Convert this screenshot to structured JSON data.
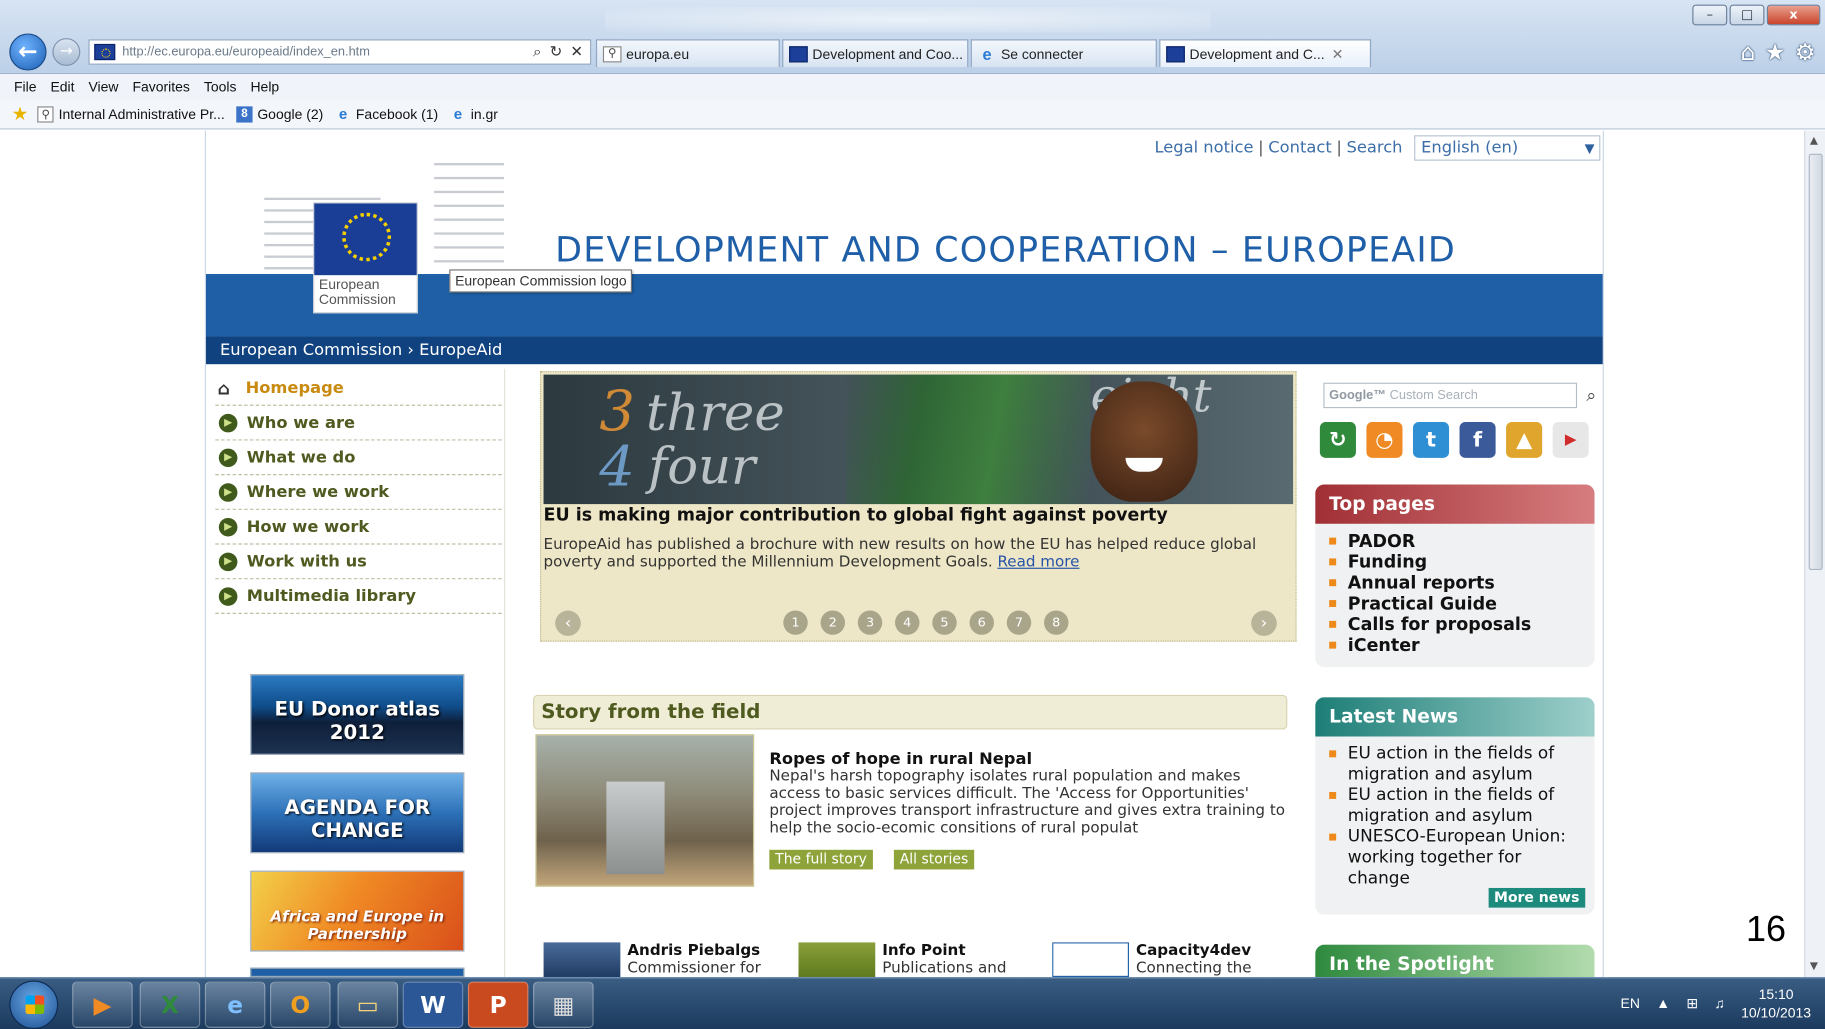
{
  "browser": {
    "address_url": "http://ec.europa.eu/europeaid/index_en.htm",
    "tabs": [
      {
        "label": "europa.eu",
        "icon": "person-page-icon"
      },
      {
        "label": "Development and Coo...",
        "icon": "eu-flag-icon"
      },
      {
        "label": "Se connecter",
        "icon": "ie-icon"
      },
      {
        "label": "Development and C...",
        "icon": "eu-flag-icon",
        "active": true
      }
    ],
    "menu": [
      "File",
      "Edit",
      "View",
      "Favorites",
      "Tools",
      "Help"
    ],
    "favorites": [
      {
        "label": "Internal Administrative Pr...",
        "icon": "person-page-icon"
      },
      {
        "label": "Google (2)",
        "icon": "google-icon"
      },
      {
        "label": "Facebook (1)",
        "icon": "ie-icon"
      },
      {
        "label": "in.gr",
        "icon": "ie-icon"
      }
    ]
  },
  "header": {
    "legal_notice": "Legal notice",
    "contact": "Contact",
    "search": "Search",
    "language": "English (en)",
    "logo_text": "European Commission",
    "tooltip": "European Commission logo",
    "site_title": "DEVELOPMENT AND COOPERATION – EUROPEAID",
    "breadcrumb": "European Commission › EuropeAid"
  },
  "nav": {
    "items": [
      {
        "label": "Homepage",
        "home": true
      },
      {
        "label": "Who we are"
      },
      {
        "label": "What we do"
      },
      {
        "label": "Where we work"
      },
      {
        "label": "How we work"
      },
      {
        "label": "Work with us"
      },
      {
        "label": "Multimedia library"
      }
    ]
  },
  "banners": [
    {
      "text": "EU Donor atlas 2012"
    },
    {
      "text": "AGENDA FOR CHANGE"
    },
    {
      "text": "Africa and Europe in Partnership"
    }
  ],
  "carousel": {
    "chalk": {
      "three_num": "3",
      "three_word": "three",
      "four_num": "4",
      "four_word": "four",
      "eight": "eight"
    },
    "title": "EU is making major contribution to global fight against poverty",
    "body": "EuropeAid has published a brochure with new results on how the EU has helped reduce global poverty and supported the Millennium Development Goals.",
    "read_more": "Read more",
    "pages": [
      "1",
      "2",
      "3",
      "4",
      "5",
      "6",
      "7",
      "8"
    ],
    "prev": "‹",
    "next": "›"
  },
  "story": {
    "heading": "Story from the field",
    "title": "Ropes of hope in rural Nepal",
    "text": "Nepal's harsh topography isolates rural population and makes access to basic services difficult. The 'Access for Opportunities' project improves transport infrastructure and gives extra training to help the socio-ecomic consitions of rural populat",
    "full_story": "The full story",
    "all_stories": "All stories"
  },
  "bottom_items": [
    {
      "title": "Andris Piebalgs",
      "subtitle": "Commissioner for"
    },
    {
      "title": "Info Point",
      "subtitle": "Publications and"
    },
    {
      "title": "Capacity4dev",
      "subtitle": "Connecting the"
    }
  ],
  "sidebar": {
    "search_placeholder_brand": "Google™",
    "search_placeholder": "Custom Search",
    "social": [
      {
        "icon": "share-icon",
        "color": "#2f8a3c"
      },
      {
        "icon": "rss-icon",
        "color": "#f08a24"
      },
      {
        "icon": "twitter-icon",
        "color": "#2f8fd4"
      },
      {
        "icon": "facebook-icon",
        "color": "#3b5a9a"
      },
      {
        "icon": "flickr-icon",
        "color": "#e0a52c"
      },
      {
        "icon": "youtube-icon",
        "color": "#e7e7e7"
      }
    ],
    "top_pages": {
      "title": "Top pages",
      "items": [
        "PADOR",
        "Funding",
        "Annual reports",
        "Practical Guide",
        "Calls for proposals",
        "iCenter"
      ]
    },
    "latest_news": {
      "title": "Latest News",
      "items": [
        "EU action in the fields of migration and asylum",
        "EU action in the fields of migration and asylum",
        "UNESCO-European Union: working together for change"
      ],
      "more": "More news"
    },
    "spotlight": {
      "title": "In the Spotlight"
    }
  },
  "taskbar": {
    "apps": [
      "media-player-icon",
      "excel-icon",
      "ie-icon",
      "outlook-icon",
      "explorer-icon",
      "word-icon",
      "powerpoint-icon",
      "calculator-icon"
    ],
    "language": "EN",
    "time": "15:10",
    "date": "10/10/2013"
  },
  "slide_number": "16"
}
